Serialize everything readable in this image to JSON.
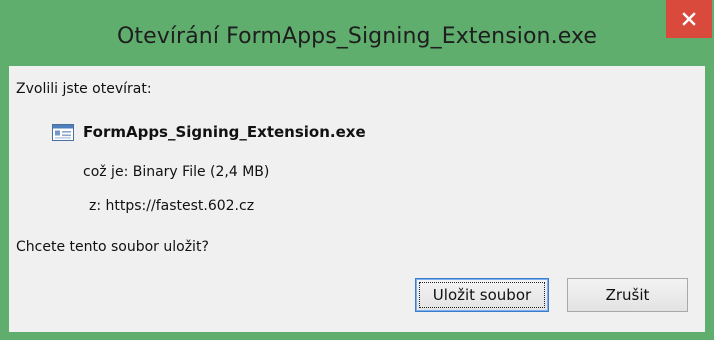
{
  "window": {
    "title": "Otevírání FormApps_Signing_Extension.exe",
    "accent_color": "#5fae6d",
    "close_icon": "close-icon"
  },
  "dialog": {
    "intro": "Zvolili jste otevírat:",
    "file": {
      "icon": "application-file-icon",
      "name": "FormApps_Signing_Extension.exe"
    },
    "type_row": "což je:  Binary File (2,4 MB)",
    "from_row": "z:  https://fastest.602.cz",
    "question": "Chcete tento soubor uložit?"
  },
  "buttons": {
    "save_label": "Uložit soubor",
    "cancel_label": "Zrušit"
  }
}
